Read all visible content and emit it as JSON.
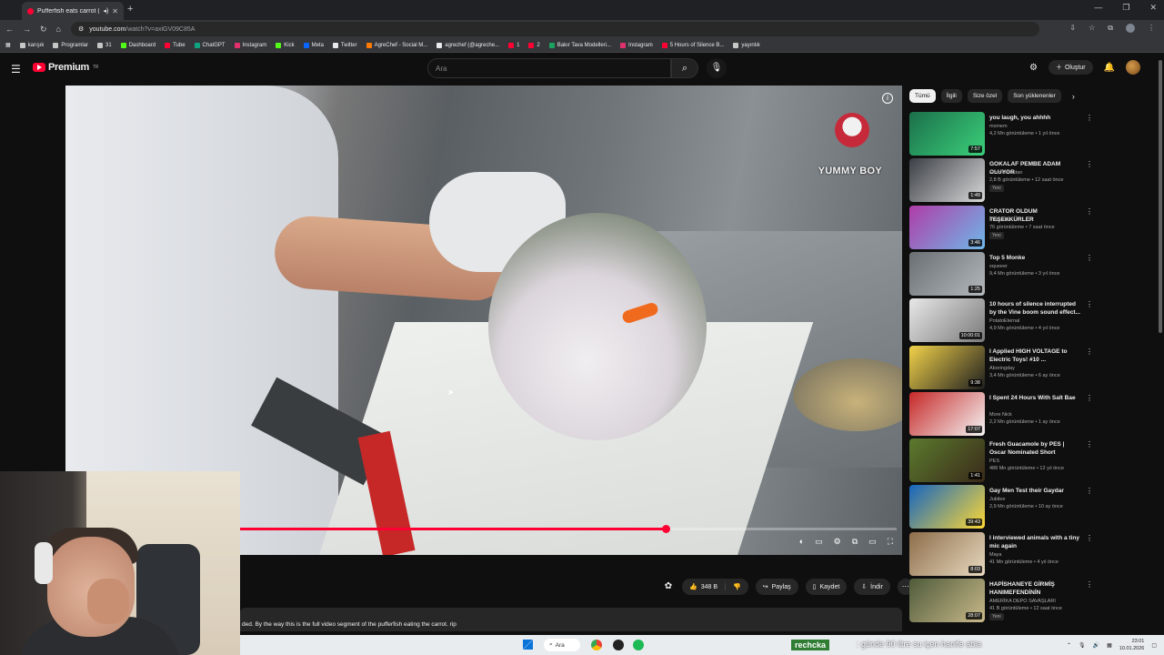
{
  "browser": {
    "tab_title": "Pufferfish eats carrot (full v...",
    "url_domain": "youtube.com",
    "url_path": "/watch?v=axiGV09C85A",
    "bookmarks": [
      {
        "label": "karışık",
        "color": "#c4c7c5"
      },
      {
        "label": "Programlar",
        "color": "#c4c7c5"
      },
      {
        "label": "31",
        "color": "#c4c7c5"
      },
      {
        "label": "Dashboard",
        "color": "#53fc18"
      },
      {
        "label": "Tube",
        "color": "#ff0033"
      },
      {
        "label": "ChatGPT",
        "color": "#10a37f"
      },
      {
        "label": "Instagram",
        "color": "#e1306c"
      },
      {
        "label": "Kick",
        "color": "#53fc18"
      },
      {
        "label": "Meta",
        "color": "#0866ff"
      },
      {
        "label": "Twitter",
        "color": "#e7e9ea"
      },
      {
        "label": "AgreChef - Social M...",
        "color": "#ff7a00"
      },
      {
        "label": "agrechef (@agreche...",
        "color": "#e7e9ea"
      },
      {
        "label": "1",
        "color": "#ff0033"
      },
      {
        "label": "2",
        "color": "#ff0033"
      },
      {
        "label": "Bakır Tava Modelleri...",
        "color": "#1aa260"
      },
      {
        "label": "Instagram",
        "color": "#e1306c"
      },
      {
        "label": "5 Hours of Silence B...",
        "color": "#ff0033"
      },
      {
        "label": "yayınlık",
        "color": "#c4c7c5"
      }
    ]
  },
  "youtube": {
    "logo": "Premium",
    "logo_region": "TR",
    "search_placeholder": "Ara",
    "create_label": "Oluştur"
  },
  "video": {
    "watermark": "YUMMY BOY",
    "progress_fraction": 0.648
  },
  "actions": {
    "likes": "348 B",
    "share": "Paylaş",
    "save": "Kaydet",
    "download": "İndir"
  },
  "description": "ded. By the way this is the full video segment of the pufferfish eating the carrot. rip",
  "chips": [
    "Tümü",
    "İlgili",
    "Size özel",
    "Son yüklenenler"
  ],
  "related": [
    {
      "title": "you laugh, you ahhhh",
      "channel": "mxmem",
      "meta": "4,2 Mn görüntüleme • 1 yıl önce",
      "duration": "7:57",
      "new": "",
      "colors": [
        "#1b6f4a",
        "#3bd07a"
      ]
    },
    {
      "title": "GOKALAF PEMBE ADAM OLUYOR",
      "channel": "Emin Doruktan",
      "meta": "2,8 B görüntüleme • 12 saat önce",
      "duration": "1:49",
      "new": "Yeni",
      "colors": [
        "#3b3f45",
        "#d8d8d8"
      ]
    },
    {
      "title": "CRATOR OLDUM TEŞEKKÜRLER",
      "channel": "Pkid sude",
      "meta": "76 görüntüleme • 7 saat önce",
      "duration": "3:46",
      "new": "Yeni",
      "colors": [
        "#b03ca8",
        "#6fb8e8"
      ]
    },
    {
      "title": "Top 5 Monke",
      "channel": "squeeer",
      "meta": "9,4 Mn görüntüleme • 3 yıl önce",
      "duration": "1:25",
      "new": "",
      "colors": [
        "#6a6f74",
        "#b3b8bc"
      ]
    },
    {
      "title": "10 hours of silence interrupted by the Vine boom sound effect...",
      "channel": "PotatoEternal",
      "meta": "4,9 Mn görüntüleme • 4 yıl önce",
      "duration": "10:00:01",
      "new": "",
      "colors": [
        "#e8e8e8",
        "#7a7a7a"
      ]
    },
    {
      "title": "I Applied HIGH VOLTAGE to Electric Toys! #10 ...",
      "channel": "Aboringday",
      "meta": "3,4 Mn görüntüleme • 6 ay önce",
      "duration": "9:38",
      "new": "",
      "colors": [
        "#f2d24a",
        "#1f1f1f"
      ]
    },
    {
      "title": "I Spent 24 Hours With Salt Bae",
      "channel": "More Nick",
      "meta": "2,2 Mn görüntüleme • 1 ay önce",
      "duration": "17:07",
      "new": "",
      "colors": [
        "#c62828",
        "#f5f5f5"
      ]
    },
    {
      "title": "Fresh Guacamole by PES | Oscar Nominated Short",
      "channel": "PES",
      "meta": "488 Mn görüntüleme • 12 yıl önce",
      "duration": "1:41",
      "new": "",
      "colors": [
        "#5b7a2e",
        "#3a2a1a"
      ]
    },
    {
      "title": "Gay Men Test their Gaydar",
      "channel": "Jubilee",
      "meta": "2,9 Mn görüntüleme • 10 ay önce",
      "duration": "39:43",
      "new": "",
      "colors": [
        "#1565c0",
        "#fdd835"
      ]
    },
    {
      "title": "I interviewed animals with a tiny mic again",
      "channel": "Maya",
      "meta": "41 Mn görüntüleme • 4 yıl önce",
      "duration": "8:03",
      "new": "",
      "colors": [
        "#8d6e4a",
        "#e8d9c0"
      ]
    },
    {
      "title": "HAPİSHANEYE GİRMİŞ HANIMEFENDİNİN DEPOSUNU...",
      "channel": "AMERİKA DEPO SAVAŞLARI",
      "meta": "41 B görüntüleme • 12 saat önce",
      "duration": "28:07",
      "new": "Yeni",
      "colors": [
        "#4e5b3a",
        "#c9b98a"
      ]
    }
  ],
  "taskbar": {
    "search_label": "Ara",
    "ticker_user": "rechcka",
    "ticker_text": ": günde 90 litre su içen hanife abla",
    "time": "23:01",
    "date": "10.01.2026"
  }
}
